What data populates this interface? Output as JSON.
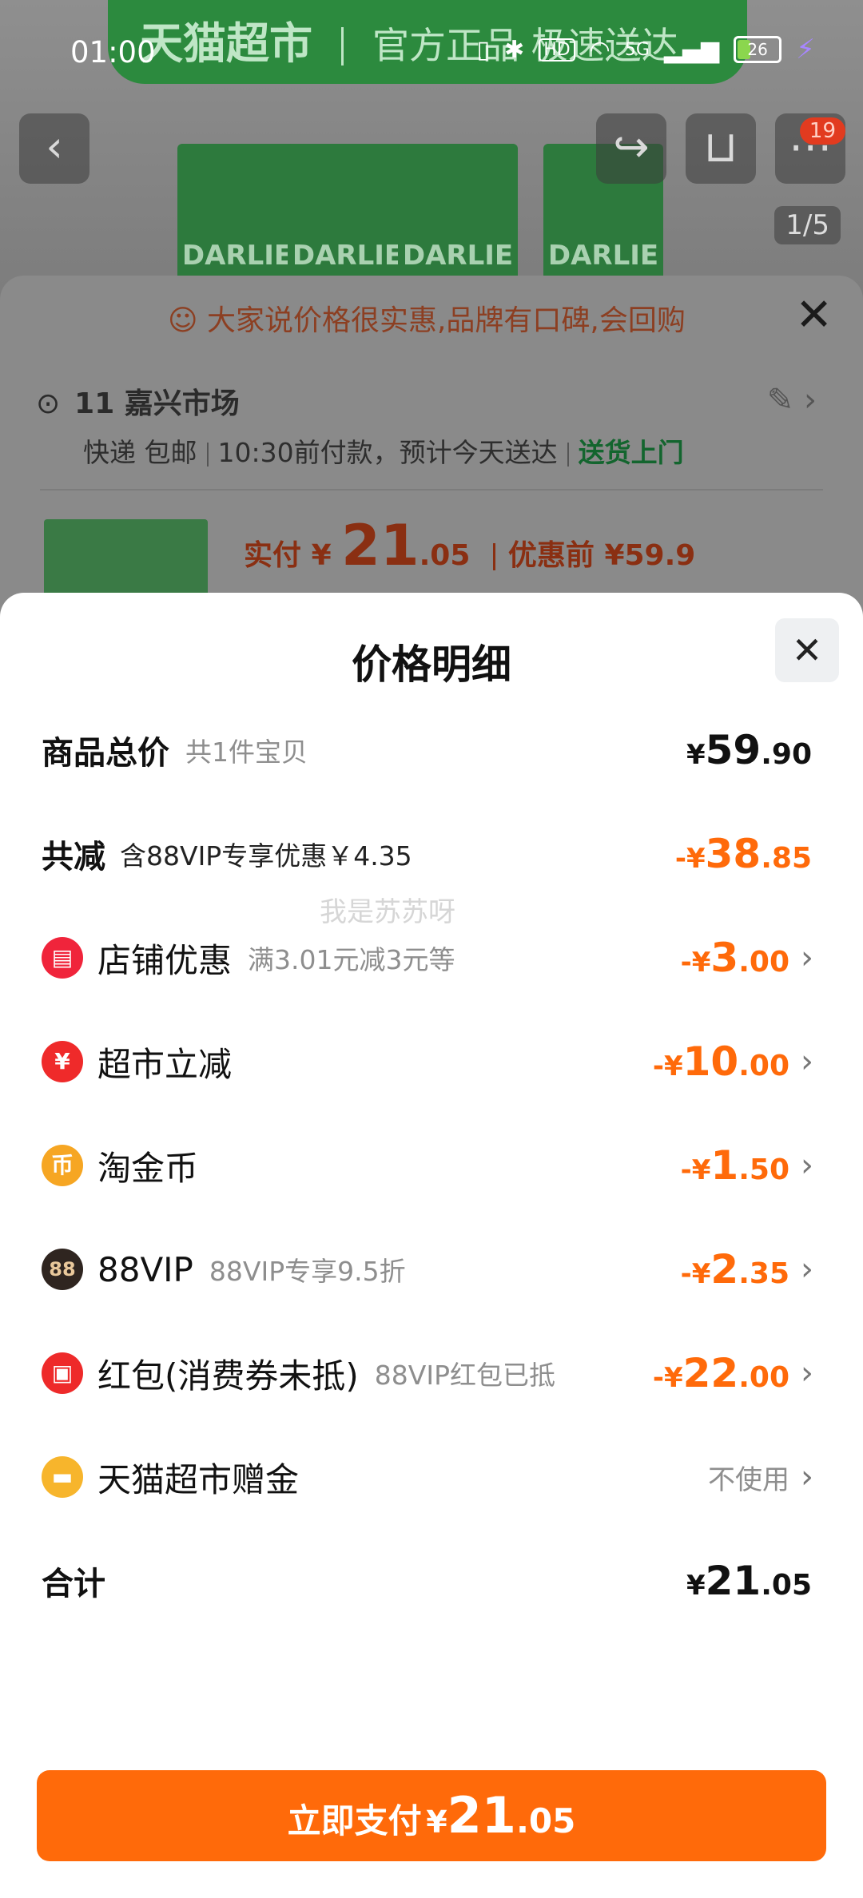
{
  "status_bar": {
    "time": "01:00",
    "network": "5G",
    "battery": "26"
  },
  "banner": {
    "title": "天猫超市",
    "subtitle": "官方正品 极速送达"
  },
  "header": {
    "cart_badge": "19",
    "image_pager": "1/5"
  },
  "product_boxes": [
    "DARLIE",
    "DARLIE",
    "DARLIE",
    "DARLIE"
  ],
  "order_card": {
    "review_text": "大家说价格很实惠,品牌有口碑,会回购",
    "address": "11 嘉兴市场",
    "delivery_mode": "快递 包邮",
    "delivery_time": "10:30前付款，预计今天送达",
    "delivery_tag": "送货上门",
    "paid_label": "实付",
    "paid_currency": "¥",
    "paid_int": "21",
    "paid_dec": ".05",
    "before_label": "优惠前 ¥59.9"
  },
  "sheet": {
    "title": "价格明细",
    "watermark": "我是苏苏呀",
    "total_goods": {
      "label": "商品总价",
      "note": "共1件宝贝",
      "cur": "¥",
      "int": "59",
      "dec": ".90"
    },
    "total_discount": {
      "label": "共减",
      "note": "含88VIP专享优惠￥4.35",
      "cur": "-¥",
      "int": "38",
      "dec": ".85"
    },
    "items": [
      {
        "icon": "store-coupon-icon",
        "icon_glyph": "▤",
        "color": "#f0243b",
        "label": "店铺优惠",
        "note": "满3.01元减3元等",
        "cur": "-¥",
        "int": "3",
        "dec": ".00"
      },
      {
        "icon": "supermarket-discount-icon",
        "icon_glyph": "¥",
        "color": "#ef2a2a",
        "label": "超市立减",
        "note": "",
        "cur": "-¥",
        "int": "10",
        "dec": ".00"
      },
      {
        "icon": "gold-coin-icon",
        "icon_glyph": "币",
        "color": "#f6a623",
        "label": "淘金币",
        "note": "",
        "cur": "-¥",
        "int": "1",
        "dec": ".50"
      },
      {
        "icon": "vip88-icon",
        "icon_glyph": "88",
        "color": "#2f2520",
        "label": "88VIP",
        "note": "88VIP专享9.5折",
        "cur": "-¥",
        "int": "2",
        "dec": ".35"
      },
      {
        "icon": "red-packet-icon",
        "icon_glyph": "▣",
        "color": "#ee2a2a",
        "label": "红包(消费券未抵)",
        "note": "88VIP红包已抵",
        "cur": "-¥",
        "int": "22",
        "dec": ".00"
      }
    ],
    "gift": {
      "icon": "gift-card-icon",
      "icon_glyph": "▬",
      "color": "#f7b52c",
      "label": "天猫超市赠金",
      "value": "不使用"
    },
    "sum": {
      "label": "合计",
      "cur": "¥",
      "int": "21",
      "dec": ".05"
    }
  },
  "pay_button": {
    "label": "立即支付",
    "cur": "¥",
    "int": "21",
    "dec": ".05"
  }
}
